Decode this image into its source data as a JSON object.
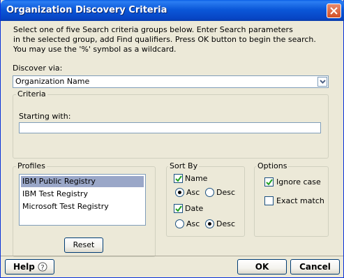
{
  "window": {
    "title": "Organization Discovery Criteria"
  },
  "instructions": {
    "line1": "Select one of five Search criteria groups below. Enter Search parameters",
    "line2": "in the selected group, add Find qualifiers. Press OK button to begin the search.",
    "line3": "You may use the '%' symbol as a wildcard."
  },
  "discover": {
    "label": "Discover via:",
    "selected": "Organization Name"
  },
  "criteria": {
    "legend": "Criteria",
    "starting_label": "Starting with:",
    "starting_value": ""
  },
  "profiles": {
    "legend": "Profiles",
    "items": [
      "IBM Public Registry",
      "IBM Test Registry",
      "Microsoft Test Registry"
    ],
    "selected_index": 0,
    "reset_label": "Reset"
  },
  "sort_by": {
    "legend": "Sort By",
    "name_label": "Name",
    "name_checked": true,
    "name_asc_label": "Asc",
    "name_desc_label": "Desc",
    "name_order": "Asc",
    "date_label": "Date",
    "date_checked": true,
    "date_asc_label": "Asc",
    "date_desc_label": "Desc",
    "date_order": "Desc"
  },
  "options": {
    "legend": "Options",
    "ignore_case_label": "Ignore case",
    "ignore_case_checked": true,
    "exact_match_label": "Exact match",
    "exact_match_checked": false
  },
  "buttons": {
    "help_label": "Help",
    "ok_label": "OK",
    "cancel_label": "Cancel"
  },
  "colors": {
    "titlebar": "#0b58d9",
    "dialog_bg": "#ece9d8",
    "selection": "#9aa7c8",
    "border_blue": "#7f9db9"
  }
}
